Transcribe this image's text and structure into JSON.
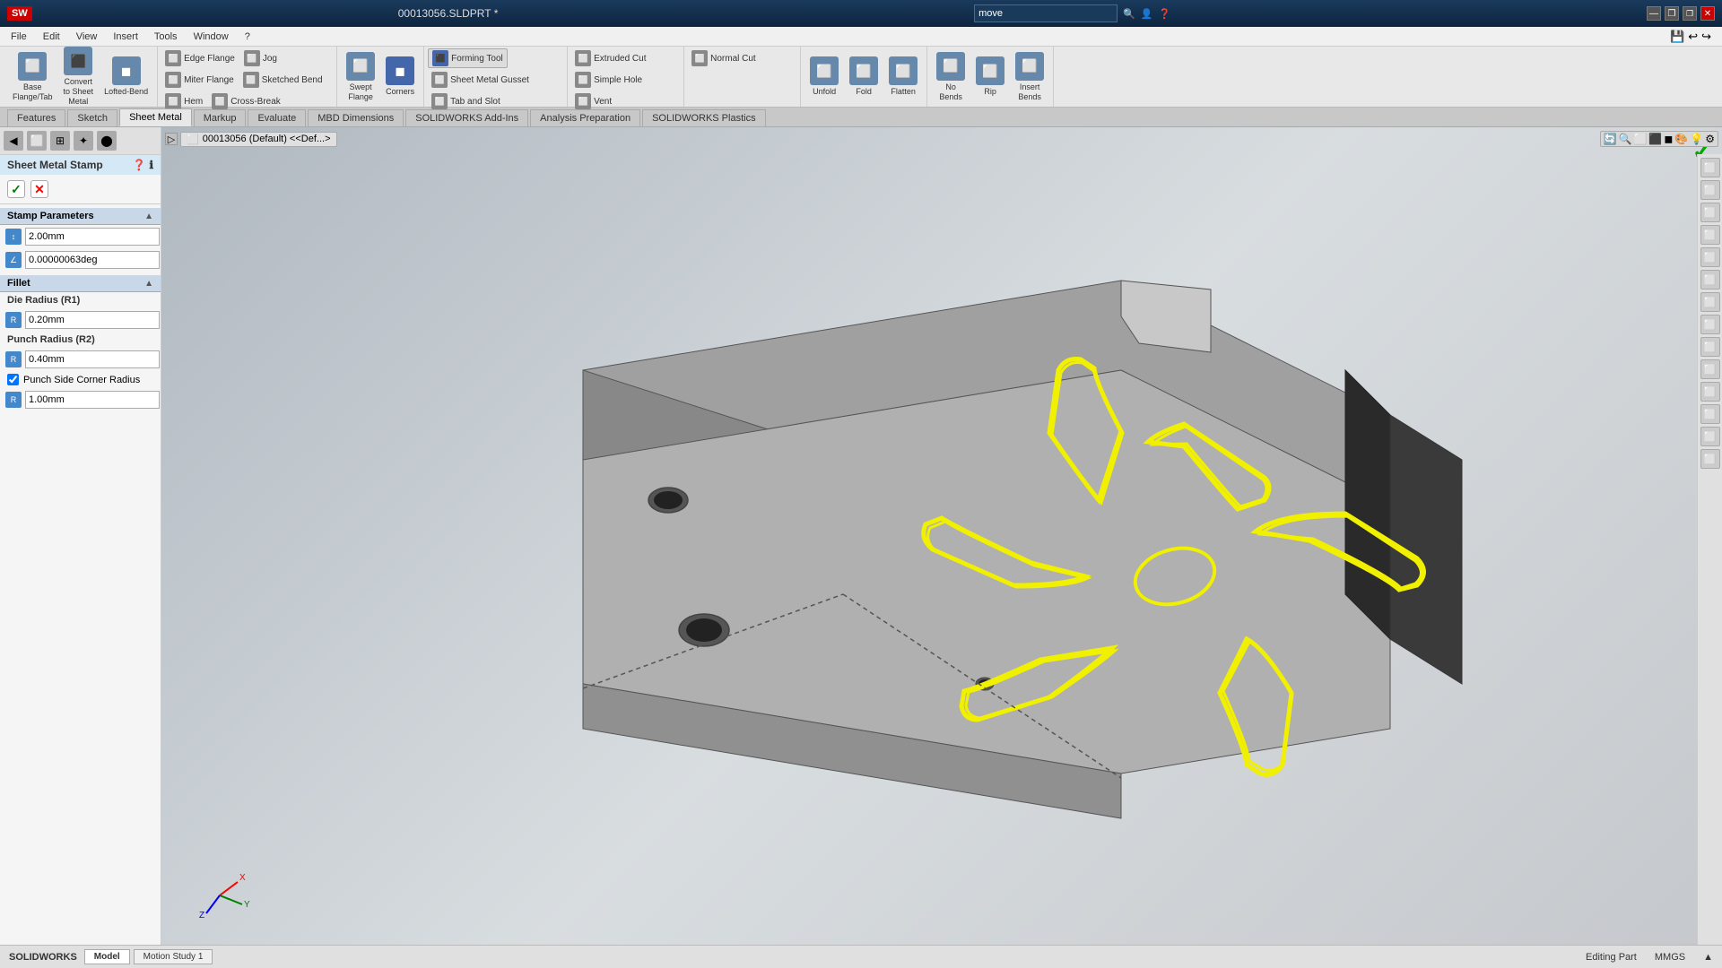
{
  "titlebar": {
    "logo": "SW",
    "title": "00013056.SLDPRT *",
    "search_placeholder": "move",
    "controls": [
      "—",
      "❐",
      "✕"
    ]
  },
  "menubar": {
    "items": [
      "File",
      "Edit",
      "View",
      "Insert",
      "Tools",
      "Window",
      "?"
    ]
  },
  "toolbar": {
    "sections": [
      {
        "name": "base-flange",
        "buttons_large": [
          {
            "label": "Base\nFlange/Tab",
            "icon": "⬜"
          },
          {
            "label": "Convert\nto Sheet\nMetal",
            "icon": "⬛"
          },
          {
            "label": "Lofted-Bend",
            "icon": "◼"
          }
        ]
      },
      {
        "name": "edges",
        "buttons_small": [
          {
            "label": "Edge Flange",
            "icon": "⬜"
          },
          {
            "label": "Miter Flange",
            "icon": "⬜"
          },
          {
            "label": "Hem",
            "icon": "⬜"
          },
          {
            "label": "Jog",
            "icon": "⬜"
          },
          {
            "label": "Sketched Bend",
            "icon": "⬜"
          },
          {
            "label": "Cross-Break",
            "icon": "⬜"
          }
        ]
      },
      {
        "name": "swept-corners",
        "buttons_large": [
          {
            "label": "Swept\nFlange",
            "icon": "⬜"
          },
          {
            "label": "Corners",
            "icon": "◼"
          }
        ]
      },
      {
        "name": "forming",
        "buttons_small": [
          {
            "label": "Forming Tool",
            "icon": "⬛"
          },
          {
            "label": "Sheet Metal Gusset",
            "icon": "⬜"
          },
          {
            "label": "Tab and Slot",
            "icon": "⬜"
          }
        ]
      },
      {
        "name": "cut-options",
        "buttons_small": [
          {
            "label": "Extruded Cut",
            "icon": "⬜"
          },
          {
            "label": "Simple Hole",
            "icon": "⬜"
          },
          {
            "label": "Vent",
            "icon": "⬜"
          }
        ]
      },
      {
        "name": "normal",
        "buttons_small": [
          {
            "label": "Normal Cut",
            "icon": "⬜"
          },
          {
            "label": "",
            "icon": ""
          },
          {
            "label": "",
            "icon": ""
          }
        ]
      },
      {
        "name": "unfold",
        "buttons_large": [
          {
            "label": "Unfold",
            "icon": "⬜"
          },
          {
            "label": "Fold",
            "icon": "⬜"
          },
          {
            "label": "Flatten",
            "icon": "⬜"
          }
        ]
      },
      {
        "name": "bends",
        "buttons_large": [
          {
            "label": "No\nBends",
            "icon": "⬜"
          },
          {
            "label": "Rip",
            "icon": "⬜"
          },
          {
            "label": "Insert\nBends",
            "icon": "⬜"
          }
        ]
      }
    ]
  },
  "ribbon_tabs": {
    "items": [
      "Features",
      "Sketch",
      "Sheet Metal",
      "Markup",
      "Evaluate",
      "MBD Dimensions",
      "SOLIDWORKS Add-Ins",
      "Analysis Preparation",
      "SOLIDWORKS Plastics"
    ],
    "active": "Sheet Metal"
  },
  "left_panel": {
    "title": "Sheet Metal Stamp",
    "ok_label": "✓",
    "cancel_label": "✕",
    "stamp_parameters": {
      "section_label": "Stamp Parameters",
      "depth_value": "2.00mm",
      "angle_value": "0.00000063deg"
    },
    "fillet": {
      "section_label": "Fillet",
      "die_radius_label": "Die Radius (R1)",
      "die_radius_value": "0.20mm",
      "punch_radius_label": "Punch Radius (R2)",
      "punch_radius_value": "0.40mm",
      "punch_side_corner": true,
      "punch_side_corner_label": "Punch Side Corner Radius",
      "corner_radius_value": "1.00mm"
    }
  },
  "breadcrumb": {
    "icon": "⬜",
    "path": "00013056 (Default) <<Def...>"
  },
  "viewport_toolbar": {
    "icons": [
      "🔍",
      "⬜",
      "⬜",
      "⬜",
      "⬜",
      "⬜",
      "⬜",
      "⬜",
      "⬜",
      "⬜",
      "⬜",
      "⬜"
    ]
  },
  "right_toolbar": {
    "buttons": [
      "⬜",
      "⬜",
      "⬜",
      "⬜",
      "⬜",
      "⬜",
      "⬜",
      "⬜",
      "⬜",
      "⬜",
      "⬜",
      "⬜",
      "⬜",
      "⬜"
    ]
  },
  "statusbar": {
    "app_name": "SOLIDWORKS",
    "tabs": [
      "Model",
      "Motion Study 1"
    ],
    "active_tab": "Model",
    "status_text": "Editing Part",
    "units": "MMGS"
  },
  "colors": {
    "accent_yellow": "#f0f000",
    "model_gray": "#909090",
    "dark_model": "#404040",
    "panel_blue": "#d5e8f5",
    "active_tab": "#e8e8e8"
  }
}
